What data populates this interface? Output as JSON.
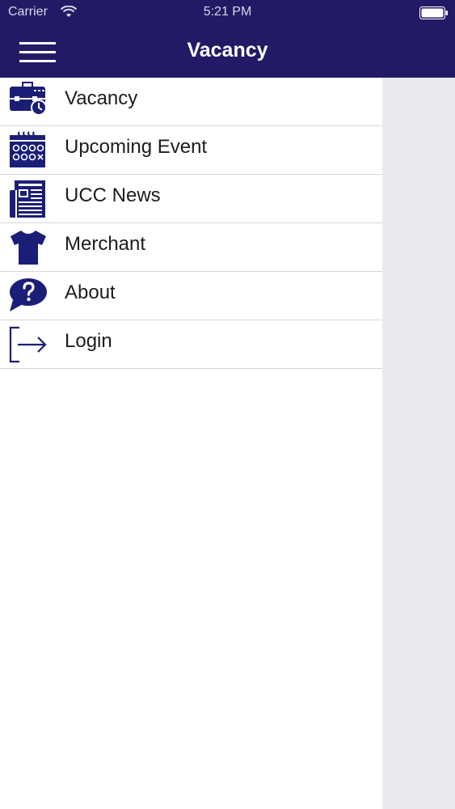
{
  "status_bar": {
    "carrier": "Carrier",
    "time": "5:21 PM"
  },
  "nav": {
    "title": "Vacancy"
  },
  "menu": {
    "items": [
      {
        "label": "Vacancy",
        "icon": "briefcase-clock-icon"
      },
      {
        "label": "Upcoming Event",
        "icon": "calendar-icon"
      },
      {
        "label": "UCC News",
        "icon": "newspaper-icon"
      },
      {
        "label": "Merchant",
        "icon": "tshirt-icon"
      },
      {
        "label": "About",
        "icon": "question-bubble-icon"
      },
      {
        "label": "Login",
        "icon": "login-arrow-icon"
      }
    ]
  },
  "colors": {
    "nav_background": "#211b66",
    "icon_color": "#1b1e77",
    "drawer_background": "#ffffff",
    "content_background": "#ebebef"
  }
}
